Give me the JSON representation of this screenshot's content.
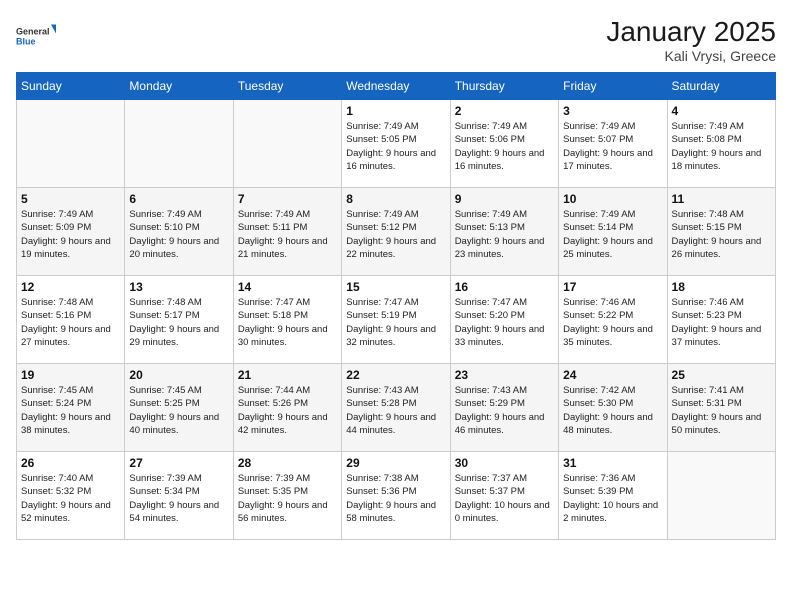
{
  "logo": {
    "general": "General",
    "blue": "Blue"
  },
  "title": "January 2025",
  "location": "Kali Vrysi, Greece",
  "days_of_week": [
    "Sunday",
    "Monday",
    "Tuesday",
    "Wednesday",
    "Thursday",
    "Friday",
    "Saturday"
  ],
  "weeks": [
    [
      {
        "day": null
      },
      {
        "day": null
      },
      {
        "day": null
      },
      {
        "day": 1,
        "sunrise": "7:49 AM",
        "sunset": "5:05 PM",
        "daylight": "9 hours and 16 minutes."
      },
      {
        "day": 2,
        "sunrise": "7:49 AM",
        "sunset": "5:06 PM",
        "daylight": "9 hours and 16 minutes."
      },
      {
        "day": 3,
        "sunrise": "7:49 AM",
        "sunset": "5:07 PM",
        "daylight": "9 hours and 17 minutes."
      },
      {
        "day": 4,
        "sunrise": "7:49 AM",
        "sunset": "5:08 PM",
        "daylight": "9 hours and 18 minutes."
      }
    ],
    [
      {
        "day": 5,
        "sunrise": "7:49 AM",
        "sunset": "5:09 PM",
        "daylight": "9 hours and 19 minutes."
      },
      {
        "day": 6,
        "sunrise": "7:49 AM",
        "sunset": "5:10 PM",
        "daylight": "9 hours and 20 minutes."
      },
      {
        "day": 7,
        "sunrise": "7:49 AM",
        "sunset": "5:11 PM",
        "daylight": "9 hours and 21 minutes."
      },
      {
        "day": 8,
        "sunrise": "7:49 AM",
        "sunset": "5:12 PM",
        "daylight": "9 hours and 22 minutes."
      },
      {
        "day": 9,
        "sunrise": "7:49 AM",
        "sunset": "5:13 PM",
        "daylight": "9 hours and 23 minutes."
      },
      {
        "day": 10,
        "sunrise": "7:49 AM",
        "sunset": "5:14 PM",
        "daylight": "9 hours and 25 minutes."
      },
      {
        "day": 11,
        "sunrise": "7:48 AM",
        "sunset": "5:15 PM",
        "daylight": "9 hours and 26 minutes."
      }
    ],
    [
      {
        "day": 12,
        "sunrise": "7:48 AM",
        "sunset": "5:16 PM",
        "daylight": "9 hours and 27 minutes."
      },
      {
        "day": 13,
        "sunrise": "7:48 AM",
        "sunset": "5:17 PM",
        "daylight": "9 hours and 29 minutes."
      },
      {
        "day": 14,
        "sunrise": "7:47 AM",
        "sunset": "5:18 PM",
        "daylight": "9 hours and 30 minutes."
      },
      {
        "day": 15,
        "sunrise": "7:47 AM",
        "sunset": "5:19 PM",
        "daylight": "9 hours and 32 minutes."
      },
      {
        "day": 16,
        "sunrise": "7:47 AM",
        "sunset": "5:20 PM",
        "daylight": "9 hours and 33 minutes."
      },
      {
        "day": 17,
        "sunrise": "7:46 AM",
        "sunset": "5:22 PM",
        "daylight": "9 hours and 35 minutes."
      },
      {
        "day": 18,
        "sunrise": "7:46 AM",
        "sunset": "5:23 PM",
        "daylight": "9 hours and 37 minutes."
      }
    ],
    [
      {
        "day": 19,
        "sunrise": "7:45 AM",
        "sunset": "5:24 PM",
        "daylight": "9 hours and 38 minutes."
      },
      {
        "day": 20,
        "sunrise": "7:45 AM",
        "sunset": "5:25 PM",
        "daylight": "9 hours and 40 minutes."
      },
      {
        "day": 21,
        "sunrise": "7:44 AM",
        "sunset": "5:26 PM",
        "daylight": "9 hours and 42 minutes."
      },
      {
        "day": 22,
        "sunrise": "7:43 AM",
        "sunset": "5:28 PM",
        "daylight": "9 hours and 44 minutes."
      },
      {
        "day": 23,
        "sunrise": "7:43 AM",
        "sunset": "5:29 PM",
        "daylight": "9 hours and 46 minutes."
      },
      {
        "day": 24,
        "sunrise": "7:42 AM",
        "sunset": "5:30 PM",
        "daylight": "9 hours and 48 minutes."
      },
      {
        "day": 25,
        "sunrise": "7:41 AM",
        "sunset": "5:31 PM",
        "daylight": "9 hours and 50 minutes."
      }
    ],
    [
      {
        "day": 26,
        "sunrise": "7:40 AM",
        "sunset": "5:32 PM",
        "daylight": "9 hours and 52 minutes."
      },
      {
        "day": 27,
        "sunrise": "7:39 AM",
        "sunset": "5:34 PM",
        "daylight": "9 hours and 54 minutes."
      },
      {
        "day": 28,
        "sunrise": "7:39 AM",
        "sunset": "5:35 PM",
        "daylight": "9 hours and 56 minutes."
      },
      {
        "day": 29,
        "sunrise": "7:38 AM",
        "sunset": "5:36 PM",
        "daylight": "9 hours and 58 minutes."
      },
      {
        "day": 30,
        "sunrise": "7:37 AM",
        "sunset": "5:37 PM",
        "daylight": "10 hours and 0 minutes."
      },
      {
        "day": 31,
        "sunrise": "7:36 AM",
        "sunset": "5:39 PM",
        "daylight": "10 hours and 2 minutes."
      },
      {
        "day": null
      }
    ]
  ]
}
